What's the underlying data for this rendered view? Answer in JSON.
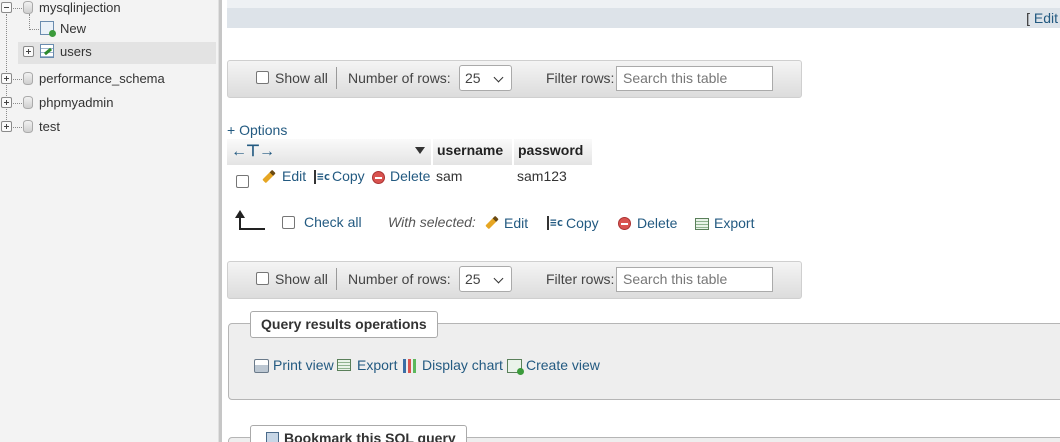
{
  "sidebar": {
    "items": [
      {
        "label": "mysqlinjection"
      },
      {
        "label": "New"
      },
      {
        "label": "users"
      },
      {
        "label": "performance_schema"
      },
      {
        "label": "phpmyadmin"
      },
      {
        "label": "test"
      }
    ]
  },
  "topbar": {
    "edit_inline": "Edit i"
  },
  "nav": {
    "show_all": "Show all",
    "rows_label": "Number of rows:",
    "rows_value": "25",
    "filter_label": "Filter rows:",
    "search_placeholder": "Search this table"
  },
  "options_link": "+ Options",
  "table": {
    "columns": [
      "username",
      "password"
    ],
    "rows": [
      {
        "edit": "Edit",
        "copy": "Copy",
        "delete": "Delete",
        "username": "sam",
        "password": "sam123"
      }
    ]
  },
  "bulk": {
    "check_all": "Check all",
    "with_selected": "With selected:",
    "edit": "Edit",
    "copy": "Copy",
    "delete": "Delete",
    "export": "Export"
  },
  "query_ops": {
    "legend": "Query results operations",
    "print_view": "Print view",
    "export": "Export",
    "display_chart": "Display chart",
    "create_view": "Create view"
  },
  "bookmark": {
    "legend": "Bookmark this SQL query"
  },
  "icons": [
    "db-icon",
    "new-icon",
    "table-icon",
    "pencil-icon",
    "copy-icon",
    "delete-icon",
    "export-icon",
    "print-icon",
    "chart-icon",
    "view-icon",
    "bookmark-icon"
  ]
}
